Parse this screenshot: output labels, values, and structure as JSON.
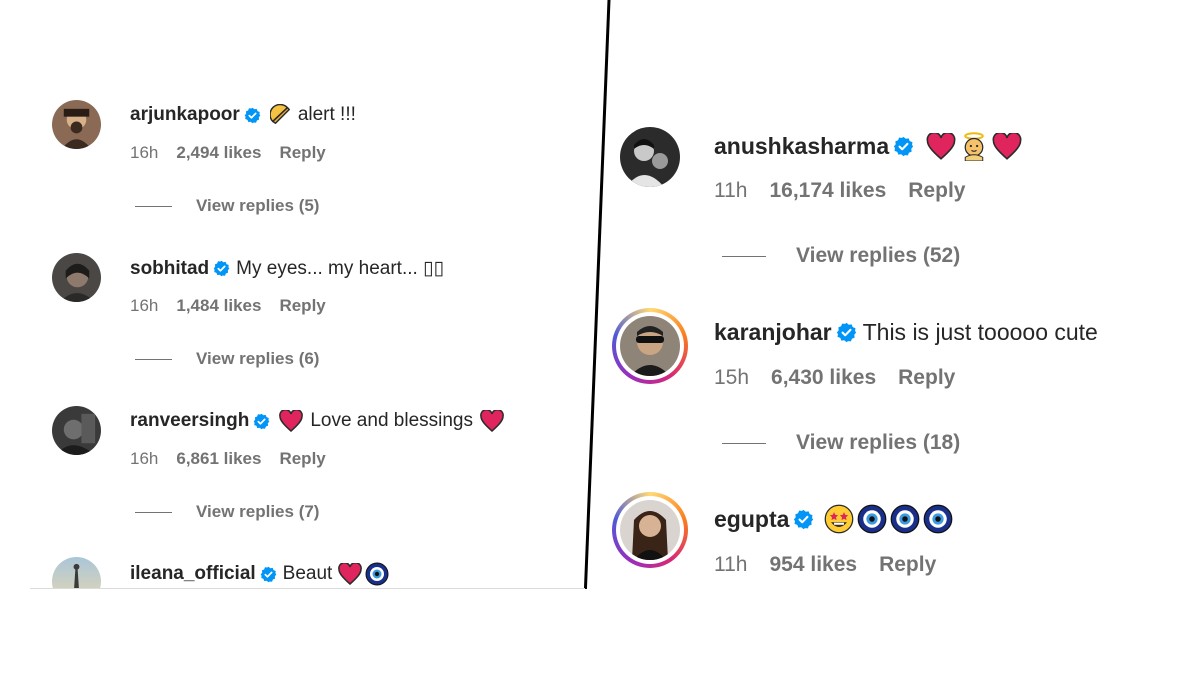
{
  "left_panel": {
    "comments": [
      {
        "username": "arjunkapoor",
        "verified": true,
        "emoji_before": [
          "taco-icon"
        ],
        "text": "alert !!!",
        "emoji_after": [],
        "time": "16h",
        "likes": "2,494 likes",
        "reply_label": "Reply",
        "view_replies": "View replies (5)"
      },
      {
        "username": "sobhitad",
        "verified": true,
        "emoji_before": [],
        "text": "My eyes... my heart... ▯▯",
        "emoji_after": [],
        "time": "16h",
        "likes": "1,484 likes",
        "reply_label": "Reply",
        "view_replies": "View replies (6)"
      },
      {
        "username": "ranveersingh",
        "verified": true,
        "emoji_before": [
          "red-heart-icon"
        ],
        "text": "Love and blessings",
        "emoji_after": [
          "red-heart-icon"
        ],
        "time": "16h",
        "likes": "6,861 likes",
        "reply_label": "Reply",
        "view_replies": "View replies (7)"
      },
      {
        "username": "ileana_official",
        "verified": true,
        "emoji_before": [],
        "text": "Beaut",
        "emoji_after": [
          "red-heart-icon",
          "nazar-amulet-icon"
        ],
        "time": "",
        "likes": "",
        "reply_label": "",
        "view_replies": ""
      }
    ]
  },
  "right_panel": {
    "comments": [
      {
        "username": "anushkasharma",
        "verified": true,
        "emoji_before": [
          "red-heart-icon",
          "baby-angel-icon",
          "red-heart-icon"
        ],
        "text": "",
        "emoji_after": [],
        "time": "11h",
        "likes": "16,174 likes",
        "reply_label": "Reply",
        "view_replies": "View replies (52)"
      },
      {
        "username": "karanjohar",
        "verified": true,
        "emoji_before": [],
        "text": "This is just tooooo cute",
        "emoji_after": [],
        "time": "15h",
        "likes": "6,430 likes",
        "reply_label": "Reply",
        "view_replies": "View replies (18)"
      },
      {
        "username": "egupta",
        "verified": true,
        "emoji_before": [
          "star-struck-icon",
          "nazar-amulet-icon",
          "nazar-amulet-icon",
          "nazar-amulet-icon"
        ],
        "text": "",
        "emoji_after": [],
        "time": "11h",
        "likes": "954 likes",
        "reply_label": "Reply",
        "view_replies": ""
      }
    ]
  },
  "colors": {
    "verified_badge": "#0095f6",
    "meta_text": "#737373",
    "primary_text": "#262626",
    "heart": "#e0245e",
    "divider": "#000000"
  }
}
